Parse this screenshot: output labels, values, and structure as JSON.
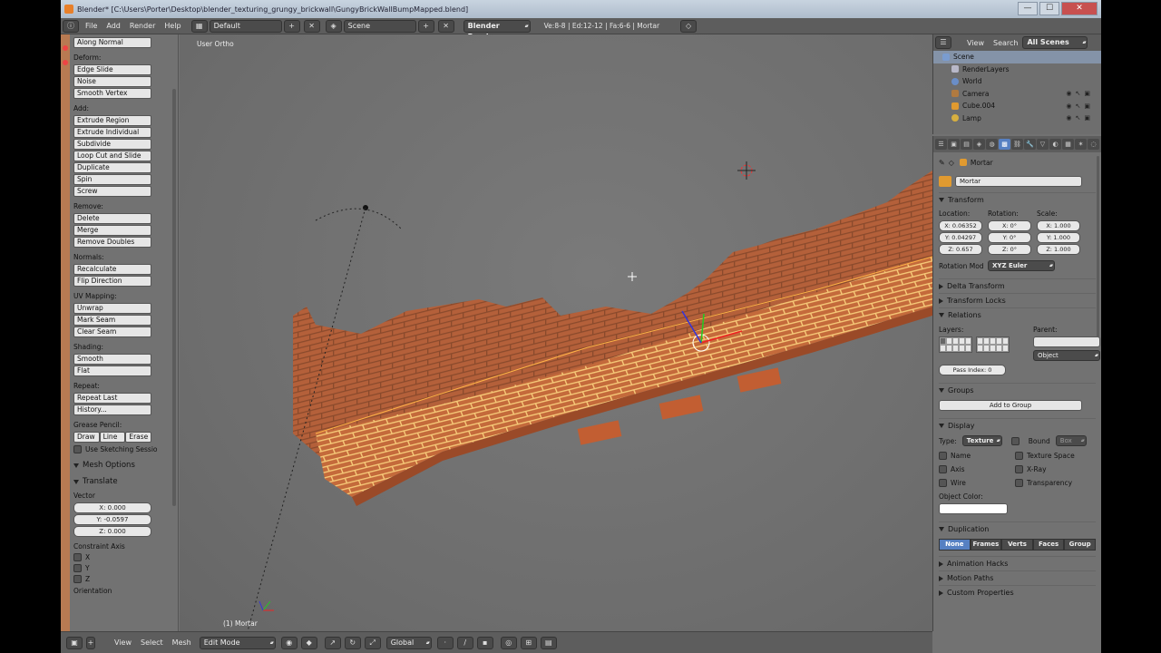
{
  "window": {
    "title": "Blender* [C:\\Users\\Porter\\Desktop\\blender_texturing_grungy_brickwall\\GungyBrickWallBumpMapped.blend]",
    "min": "—",
    "max": "☐",
    "close": "✕"
  },
  "infobar": {
    "menus": [
      "File",
      "Add",
      "Render",
      "Help"
    ],
    "layout": "Default",
    "scene": "Scene",
    "engine": "Blender Render",
    "stats": "Ve:8-8 | Ed:12-12 | Fa:6-6 | Mortar"
  },
  "toolshelf": {
    "along_normal": "Along Normal",
    "deform_label": "Deform:",
    "deform": [
      "Edge Slide",
      "Noise",
      "Smooth Vertex"
    ],
    "add_label": "Add:",
    "add": [
      "Extrude Region",
      "Extrude Individual",
      "Subdivide",
      "Loop Cut and Slide",
      "Duplicate",
      "Spin",
      "Screw"
    ],
    "remove_label": "Remove:",
    "remove": [
      "Delete",
      "Merge",
      "Remove Doubles"
    ],
    "normals_label": "Normals:",
    "normals": [
      "Recalculate",
      "Flip Direction"
    ],
    "uv_label": "UV Mapping:",
    "uv": [
      "Unwrap",
      "Mark Seam",
      "Clear Seam"
    ],
    "shading_label": "Shading:",
    "shading": [
      "Smooth",
      "Flat"
    ],
    "repeat_label": "Repeat:",
    "repeat": [
      "Repeat Last",
      "History..."
    ],
    "grease_label": "Grease Pencil:",
    "grease": [
      "Draw",
      "Line",
      "Erase"
    ],
    "use_sketching": "Use Sketching Sessio",
    "mesh_options": "Mesh Options",
    "translate": "Translate",
    "vector_label": "Vector",
    "vector": [
      "X: 0.000",
      "Y: -0.0597",
      "Z: 0.000"
    ],
    "constraint_label": "Constraint Axis",
    "constraints": [
      "X",
      "Y",
      "Z"
    ],
    "orientation": "Orientation"
  },
  "viewport": {
    "label": "User Ortho",
    "object": "(1) Mortar"
  },
  "bottombar": {
    "menus": [
      "View",
      "Select",
      "Mesh"
    ],
    "mode": "Edit Mode",
    "orientation": "Global"
  },
  "outliner": {
    "view": "View",
    "search": "Search",
    "filter": "All Scenes",
    "items": [
      {
        "label": "Scene",
        "color": "#7a9ccf"
      },
      {
        "label": "RenderLayers",
        "color": "#b8b8c8"
      },
      {
        "label": "World",
        "color": "#6a8ec8"
      },
      {
        "label": "Camera",
        "color": "#b07a40"
      },
      {
        "label": "Cube.004",
        "color": "#e09a30"
      },
      {
        "label": "Lamp",
        "color": "#d8b040"
      }
    ]
  },
  "properties": {
    "breadcrumb": "Mortar",
    "object_name": "Mortar",
    "transform": "Transform",
    "location_label": "Location:",
    "rotation_label": "Rotation:",
    "scale_label": "Scale:",
    "location": [
      "X: 0.06352",
      "Y: 0.04297",
      "Z: 0.657"
    ],
    "rotation": [
      "X: 0°",
      "Y: 0°",
      "Z: 0°"
    ],
    "scale": [
      "X: 1.000",
      "Y: 1.000",
      "Z: 1.000"
    ],
    "rotation_mode_label": "Rotation Mod",
    "rotation_mode": "XYZ Euler",
    "delta_transform": "Delta Transform",
    "transform_locks": "Transform Locks",
    "relations": "Relations",
    "layers_label": "Layers:",
    "parent_label": "Parent:",
    "parent_type": "Object",
    "pass_index": "Pass Index: 0",
    "groups": "Groups",
    "add_to_group": "Add to Group",
    "display": "Display",
    "type_label": "Type:",
    "type": "Texture",
    "bound": "Bound",
    "bound_type": "Box",
    "checks_left": [
      "Name",
      "Axis",
      "Wire"
    ],
    "checks_right": [
      "Texture Space",
      "X-Ray",
      "Transparency"
    ],
    "object_color_label": "Object Color:",
    "duplication": "Duplication",
    "dup_options": [
      "None",
      "Frames",
      "Verts",
      "Faces",
      "Group"
    ],
    "animation_hacks": "Animation Hacks",
    "motion_paths": "Motion Paths",
    "custom_properties": "Custom Properties"
  },
  "colors": {
    "accent": "#5680c2",
    "brick": "#c8693a",
    "mortar_highlight": "#ffd27a"
  }
}
